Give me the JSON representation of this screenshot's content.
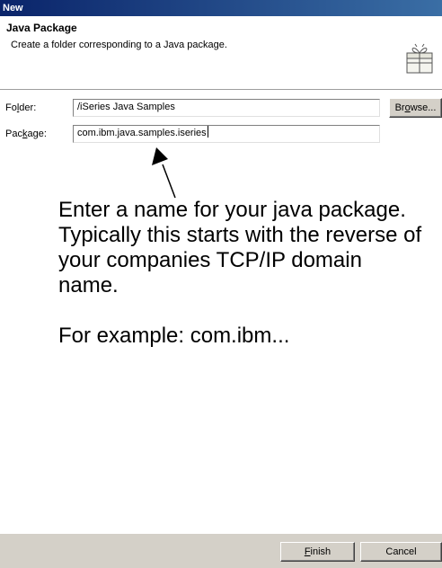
{
  "window": {
    "title": "New"
  },
  "banner": {
    "title": "Java Package",
    "description": "Create a folder corresponding to a Java package.",
    "icon": "package-icon"
  },
  "form": {
    "folder": {
      "label_pre": "Fo",
      "label_mn": "l",
      "label_post": "der:",
      "value": "/iSeries Java Samples"
    },
    "package": {
      "label_pre": "Pac",
      "label_mn": "k",
      "label_post": "age:",
      "value": "com.ibm.java.samples.iseries"
    },
    "browse_button": {
      "pre": "Br",
      "mn": "o",
      "post": "wse..."
    }
  },
  "annotation": {
    "paragraph1": "Enter a name for your java package.  Typically this starts with the reverse of your companies TCP/IP domain name.",
    "paragraph2": "For example:  com.ibm..."
  },
  "buttons": {
    "finish": {
      "mn": "F",
      "post": "inish"
    },
    "cancel": "Cancel"
  }
}
